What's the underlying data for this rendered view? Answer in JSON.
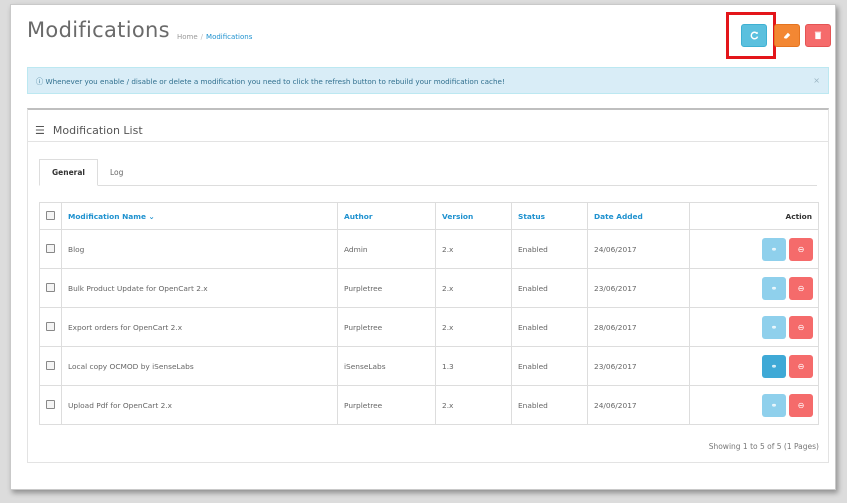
{
  "header": {
    "title": "Modifications",
    "breadcrumb": [
      "Home",
      "Modifications"
    ]
  },
  "toolbar": {
    "refresh_icon": "refresh-icon",
    "clear_icon": "eraser-icon",
    "delete_icon": "trash-icon"
  },
  "alert": {
    "text": "Whenever you enable / disable or delete a modification you need to click the refresh button to rebuild your modification cache!",
    "close": "×"
  },
  "panel": {
    "title": "Modification List",
    "tabs": [
      "General",
      "Log"
    ],
    "active_tab": "General"
  },
  "table": {
    "columns": [
      "Modification Name",
      "Author",
      "Version",
      "Status",
      "Date Added",
      "Action"
    ],
    "rows": [
      {
        "name": "Blog",
        "author": "Admin",
        "version": "2.x",
        "status": "Enabled",
        "date": "24/06/2017"
      },
      {
        "name": "Bulk Product Update for OpenCart 2.x",
        "author": "Purpletree",
        "version": "2.x",
        "status": "Enabled",
        "date": "23/06/2017"
      },
      {
        "name": "Export orders for OpenCart 2.x",
        "author": "Purpletree",
        "version": "2.x",
        "status": "Enabled",
        "date": "28/06/2017"
      },
      {
        "name": "Local copy OCMOD by iSenseLabs",
        "author": "iSenseLabs",
        "version": "1.3",
        "status": "Enabled",
        "date": "23/06/2017"
      },
      {
        "name": "Upload Pdf for OpenCart 2.x",
        "author": "Purpletree",
        "version": "2.x",
        "status": "Enabled",
        "date": "24/06/2017"
      }
    ]
  },
  "pagination": {
    "text": "Showing 1 to 5 of 5 (1 Pages)"
  },
  "colors": {
    "primary": "#1e91cf",
    "info": "#5bc0de",
    "warning": "#f38733",
    "danger": "#f56b6b",
    "highlight": "#e3151a"
  }
}
